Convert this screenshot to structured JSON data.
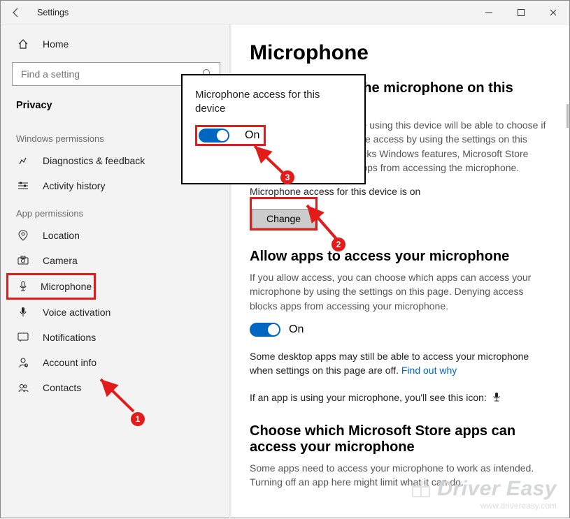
{
  "window": {
    "title": "Settings"
  },
  "sidebar": {
    "home": "Home",
    "search_placeholder": "Find a setting",
    "privacy": "Privacy",
    "win_perm_label": "Windows permissions",
    "app_perm_label": "App permissions",
    "win_items": [
      {
        "icon": "diagnostics",
        "label": "Diagnostics & feedback"
      },
      {
        "icon": "activity",
        "label": "Activity history"
      }
    ],
    "app_items": [
      {
        "icon": "location",
        "label": "Location"
      },
      {
        "icon": "camera",
        "label": "Camera"
      },
      {
        "icon": "microphone",
        "label": "Microphone"
      },
      {
        "icon": "voice",
        "label": "Voice activation"
      },
      {
        "icon": "notifications",
        "label": "Notifications"
      },
      {
        "icon": "account",
        "label": "Account info"
      },
      {
        "icon": "contacts",
        "label": "Contacts"
      }
    ]
  },
  "main": {
    "title": "Microphone",
    "section1_title": "Allow access to the microphone on this device",
    "section1_body": "If you allow access, people using this device will be able to choose if their apps have microphone access by using the settings on this page. Denying access blocks Windows features, Microsoft Store apps, and most desktop apps from accessing the microphone.",
    "section1_status": "Microphone access for this device is on",
    "change": "Change",
    "section2_title": "Allow apps to access your microphone",
    "section2_body": "If you allow access, you can choose which apps can access your microphone by using the settings on this page. Denying access blocks apps from accessing your microphone.",
    "toggle_state": "On",
    "desktop_note_a": "Some desktop apps may still be able to access your microphone when settings on this page are off. ",
    "desktop_note_link": "Find out why",
    "icon_note": "If an app is using your microphone, you'll see this icon:",
    "section3_title": "Choose which Microsoft Store apps can access your microphone",
    "section3_body": "Some apps need to access your microphone to work as intended. Turning off an app here might limit what it can do."
  },
  "popup": {
    "title": "Microphone access for this device",
    "toggle_state": "On"
  },
  "annotations": {
    "badge1": "1",
    "badge2": "2",
    "badge3": "3"
  },
  "watermark": {
    "brand": "Driver Easy",
    "url": "www.drivereasy.com"
  }
}
